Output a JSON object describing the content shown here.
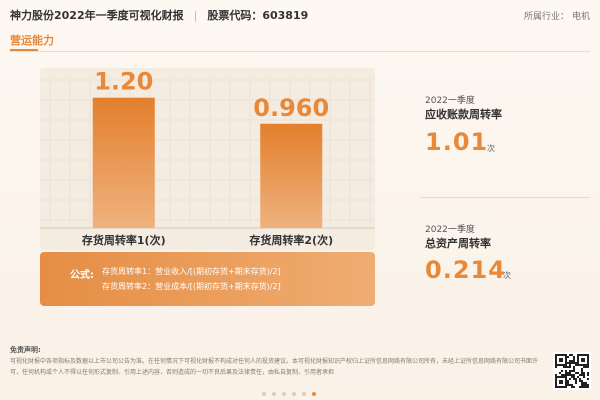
{
  "header": {
    "company_title": "神力股份2022年一季度可视化财报",
    "stock_code_label": "股票代码：603819",
    "industry_label": "所属行业：",
    "industry_value": "电机"
  },
  "section": {
    "title": "营运能力"
  },
  "chart_data": {
    "type": "bar",
    "categories": [
      "存货周转率1(次)",
      "存货周转率2(次)"
    ],
    "values": [
      1.2,
      0.96
    ],
    "value_labels": [
      "1.20",
      "0.960"
    ],
    "ylim": [
      0,
      1.4
    ],
    "grid": true,
    "bar_color": "#e8893a"
  },
  "formula": {
    "label": "公式:",
    "line1": "存货周转率1：营业收入/[(期初存货+期末存货)/2]",
    "line2": "存货周转率2：营业成本/[(期初存货+期末存货)/2]"
  },
  "metrics": [
    {
      "period": "2022一季度",
      "name": "应收账款周转率",
      "value": "1.01",
      "unit": "次"
    },
    {
      "period": "2022一季度",
      "name": "总资产周转率",
      "value": "0.214",
      "unit": "次"
    }
  ],
  "disclaimer": {
    "title": "免责声明:",
    "text": "可视化财报中各项指标及数据以上市公司公告为准。在任何情况下可视化财报不构成对任何人的投资建议。本可视化财报知识产权归上证所信息网络有限公司所有，未经上证所信息网络有限公司书面许可，任何机构或个人不得以任何形式复制、引用上述内容，否则造成的一切不良后果及法律责任，由私自复制、引用者承担"
  },
  "pager": {
    "count": 6,
    "active_index": 5
  },
  "colors": {
    "accent": "#e8893a",
    "background": "#fdf8f2"
  },
  "icons": {
    "qr": "qr-code-icon"
  }
}
